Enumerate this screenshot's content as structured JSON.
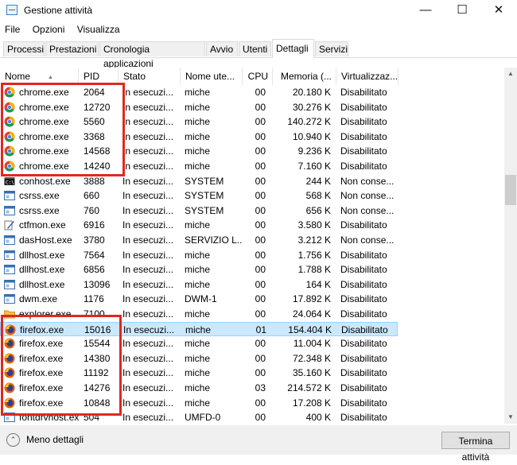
{
  "window": {
    "title": "Gestione attività",
    "min_icon": "minimize-icon",
    "max_icon": "maximize-icon",
    "close_icon": "close-icon"
  },
  "menu": [
    "File",
    "Opzioni",
    "Visualizza"
  ],
  "tabs": [
    "Processi",
    "Prestazioni",
    "Cronologia applicazioni",
    "Avvio",
    "Utenti",
    "Dettagli",
    "Servizi"
  ],
  "active_tab": "Dettagli",
  "columns": [
    "Nome",
    "PID",
    "Stato",
    "Nome ute...",
    "CPU",
    "Memoria (...",
    "Virtualizzaz..."
  ],
  "rows": [
    {
      "icon": "chrome",
      "name": "chrome.exe",
      "pid": "2064",
      "status": "In esecuzi...",
      "user": "miche",
      "cpu": "00",
      "mem": "20.180 K",
      "virt": "Disabilitato"
    },
    {
      "icon": "chrome",
      "name": "chrome.exe",
      "pid": "12720",
      "status": "In esecuzi...",
      "user": "miche",
      "cpu": "00",
      "mem": "30.276 K",
      "virt": "Disabilitato"
    },
    {
      "icon": "chrome",
      "name": "chrome.exe",
      "pid": "5560",
      "status": "In esecuzi...",
      "user": "miche",
      "cpu": "00",
      "mem": "140.272 K",
      "virt": "Disabilitato"
    },
    {
      "icon": "chrome",
      "name": "chrome.exe",
      "pid": "3368",
      "status": "In esecuzi...",
      "user": "miche",
      "cpu": "00",
      "mem": "10.940 K",
      "virt": "Disabilitato"
    },
    {
      "icon": "chrome",
      "name": "chrome.exe",
      "pid": "14568",
      "status": "In esecuzi...",
      "user": "miche",
      "cpu": "00",
      "mem": "9.236 K",
      "virt": "Disabilitato"
    },
    {
      "icon": "chrome",
      "name": "chrome.exe",
      "pid": "14240",
      "status": "In esecuzi...",
      "user": "miche",
      "cpu": "00",
      "mem": "7.160 K",
      "virt": "Disabilitato"
    },
    {
      "icon": "console",
      "name": "conhost.exe",
      "pid": "3888",
      "status": "In esecuzi...",
      "user": "SYSTEM",
      "cpu": "00",
      "mem": "244 K",
      "virt": "Non conse..."
    },
    {
      "icon": "window",
      "name": "csrss.exe",
      "pid": "660",
      "status": "In esecuzi...",
      "user": "SYSTEM",
      "cpu": "00",
      "mem": "568 K",
      "virt": "Non conse..."
    },
    {
      "icon": "window",
      "name": "csrss.exe",
      "pid": "760",
      "status": "In esecuzi...",
      "user": "SYSTEM",
      "cpu": "00",
      "mem": "656 K",
      "virt": "Non conse..."
    },
    {
      "icon": "pen",
      "name": "ctfmon.exe",
      "pid": "6916",
      "status": "In esecuzi...",
      "user": "miche",
      "cpu": "00",
      "mem": "3.580 K",
      "virt": "Disabilitato"
    },
    {
      "icon": "window",
      "name": "dasHost.exe",
      "pid": "3780",
      "status": "In esecuzi...",
      "user": "SERVIZIO L...",
      "cpu": "00",
      "mem": "3.212 K",
      "virt": "Non conse..."
    },
    {
      "icon": "window",
      "name": "dllhost.exe",
      "pid": "7564",
      "status": "In esecuzi...",
      "user": "miche",
      "cpu": "00",
      "mem": "1.756 K",
      "virt": "Disabilitato"
    },
    {
      "icon": "window",
      "name": "dllhost.exe",
      "pid": "6856",
      "status": "In esecuzi...",
      "user": "miche",
      "cpu": "00",
      "mem": "1.788 K",
      "virt": "Disabilitato"
    },
    {
      "icon": "window",
      "name": "dllhost.exe",
      "pid": "13096",
      "status": "In esecuzi...",
      "user": "miche",
      "cpu": "00",
      "mem": "164 K",
      "virt": "Disabilitato"
    },
    {
      "icon": "window",
      "name": "dwm.exe",
      "pid": "1176",
      "status": "In esecuzi...",
      "user": "DWM-1",
      "cpu": "00",
      "mem": "17.892 K",
      "virt": "Disabilitato"
    },
    {
      "icon": "folder",
      "name": "explorer.exe",
      "pid": "7100",
      "status": "In esecuzi...",
      "user": "miche",
      "cpu": "00",
      "mem": "24.064 K",
      "virt": "Disabilitato"
    },
    {
      "icon": "firefox",
      "name": "firefox.exe",
      "pid": "15016",
      "status": "In esecuzi...",
      "user": "miche",
      "cpu": "01",
      "mem": "154.404 K",
      "virt": "Disabilitato",
      "selected": true
    },
    {
      "icon": "firefox",
      "name": "firefox.exe",
      "pid": "15544",
      "status": "In esecuzi...",
      "user": "miche",
      "cpu": "00",
      "mem": "11.004 K",
      "virt": "Disabilitato"
    },
    {
      "icon": "firefox",
      "name": "firefox.exe",
      "pid": "14380",
      "status": "In esecuzi...",
      "user": "miche",
      "cpu": "00",
      "mem": "72.348 K",
      "virt": "Disabilitato"
    },
    {
      "icon": "firefox",
      "name": "firefox.exe",
      "pid": "11192",
      "status": "In esecuzi...",
      "user": "miche",
      "cpu": "00",
      "mem": "35.160 K",
      "virt": "Disabilitato"
    },
    {
      "icon": "firefox",
      "name": "firefox.exe",
      "pid": "14276",
      "status": "In esecuzi...",
      "user": "miche",
      "cpu": "03",
      "mem": "214.572 K",
      "virt": "Disabilitato"
    },
    {
      "icon": "firefox",
      "name": "firefox.exe",
      "pid": "10848",
      "status": "In esecuzi...",
      "user": "miche",
      "cpu": "00",
      "mem": "17.208 K",
      "virt": "Disabilitato"
    },
    {
      "icon": "window",
      "name": "fontdrvhost.exe",
      "pid": "504",
      "status": "In esecuzi...",
      "user": "UMFD-0",
      "cpu": "00",
      "mem": "400 K",
      "virt": "Disabilitato"
    }
  ],
  "footer": {
    "less_details": "Meno dettagli",
    "end_task": "Termina attività"
  },
  "colors": {
    "highlight_box": "#e0281f",
    "selected_row": "#cce8ff"
  }
}
